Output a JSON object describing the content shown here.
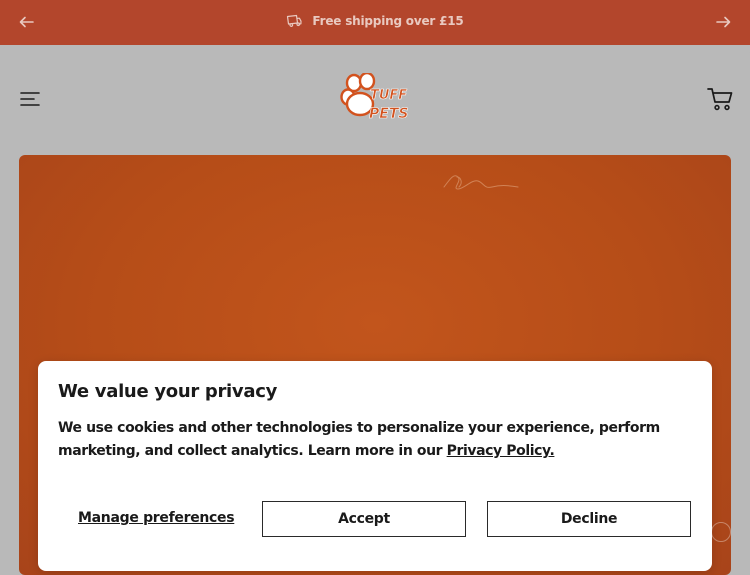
{
  "announcement": {
    "text": "Free shipping over £15",
    "prev_icon": "arrow-left-icon",
    "next_icon": "arrow-right-icon",
    "icon": "truck-icon"
  },
  "header": {
    "menu_icon": "hamburger-menu-icon",
    "logo_text_line1": "TUFF",
    "logo_text_line2": "PETS",
    "cart_icon": "cart-icon"
  },
  "consent": {
    "title": "We value your privacy",
    "body_text": "We use cookies and other technologies to personalize your experience, perform marketing, and collect analytics. Learn more in our ",
    "policy_link": "Privacy Policy.",
    "manage_label": "Manage preferences",
    "accept_label": "Accept",
    "decline_label": "Decline"
  },
  "colors": {
    "announcement_bg": "#b3462c",
    "hero_bg": "#b64d18",
    "brand": "#d2521e"
  }
}
